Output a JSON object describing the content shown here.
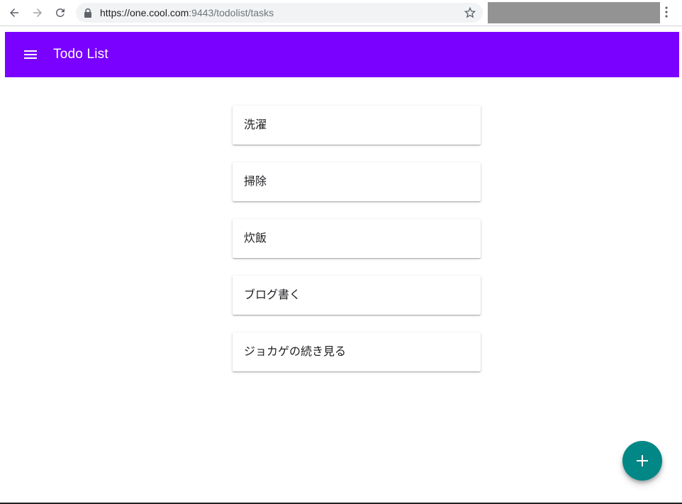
{
  "browser": {
    "url_host": "https://one.cool.com",
    "url_path": ":9443/todolist/tasks",
    "icons": {
      "back": "arrow-left-icon",
      "forward": "arrow-right-icon",
      "reload": "reload-icon",
      "lock": "lock-icon",
      "bookmark": "star-icon",
      "menu": "vertical-dots-icon"
    }
  },
  "app_bar": {
    "title": "Todo List",
    "menu_icon": "hamburger-menu-icon",
    "color": "#7a00ff"
  },
  "tasks": [
    {
      "label": "洗濯"
    },
    {
      "label": "掃除"
    },
    {
      "label": "炊飯"
    },
    {
      "label": "ブログ書く"
    },
    {
      "label": "ジョカゲの続き見る"
    }
  ],
  "fab": {
    "icon": "plus-icon",
    "color": "#018786"
  }
}
